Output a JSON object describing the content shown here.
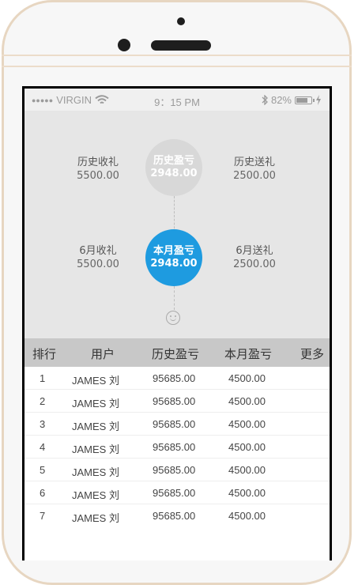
{
  "status_bar": {
    "dots": "●●●●●",
    "carrier": "VIRGIN",
    "wifi_icon": "wifi-icon",
    "time": "9：15 PM",
    "bluetooth_icon": "bluetooth-icon",
    "battery_percent": "82%",
    "battery_level": 0.82,
    "charging_icon": "charging-icon"
  },
  "summary": {
    "history_received_label": "历史收礼",
    "history_received_value": "5500.00",
    "history_profit_label": "历史盈亏",
    "history_profit_value": "2948.00",
    "history_sent_label": "历史送礼",
    "history_sent_value": "2500.00",
    "month_received_label": "6月收礼",
    "month_received_value": "5500.00",
    "month_profit_label": "本月盈亏",
    "month_profit_value": "2948.00",
    "month_sent_label": "6月送礼",
    "month_sent_value": "2500.00",
    "smile_icon": "smile-icon",
    "colors": {
      "highlight": "#1e9be0",
      "muted_circle": "#d8d8d8",
      "panel": "#e6e6e6"
    }
  },
  "table": {
    "headers": [
      "排行",
      "用户",
      "历史盈亏",
      "本月盈亏",
      "更多"
    ],
    "rows": [
      {
        "rank": "1",
        "user": "JAMES 刘",
        "history": "95685.00",
        "month": "4500.00"
      },
      {
        "rank": "2",
        "user": "JAMES 刘",
        "history": "95685.00",
        "month": "4500.00"
      },
      {
        "rank": "3",
        "user": "JAMES 刘",
        "history": "95685.00",
        "month": "4500.00"
      },
      {
        "rank": "4",
        "user": "JAMES 刘",
        "history": "95685.00",
        "month": "4500.00"
      },
      {
        "rank": "5",
        "user": "JAMES 刘",
        "history": "95685.00",
        "month": "4500.00"
      },
      {
        "rank": "6",
        "user": "JAMES 刘",
        "history": "95685.00",
        "month": "4500.00"
      },
      {
        "rank": "7",
        "user": "JAMES 刘",
        "history": "95685.00",
        "month": "4500.00"
      }
    ]
  }
}
